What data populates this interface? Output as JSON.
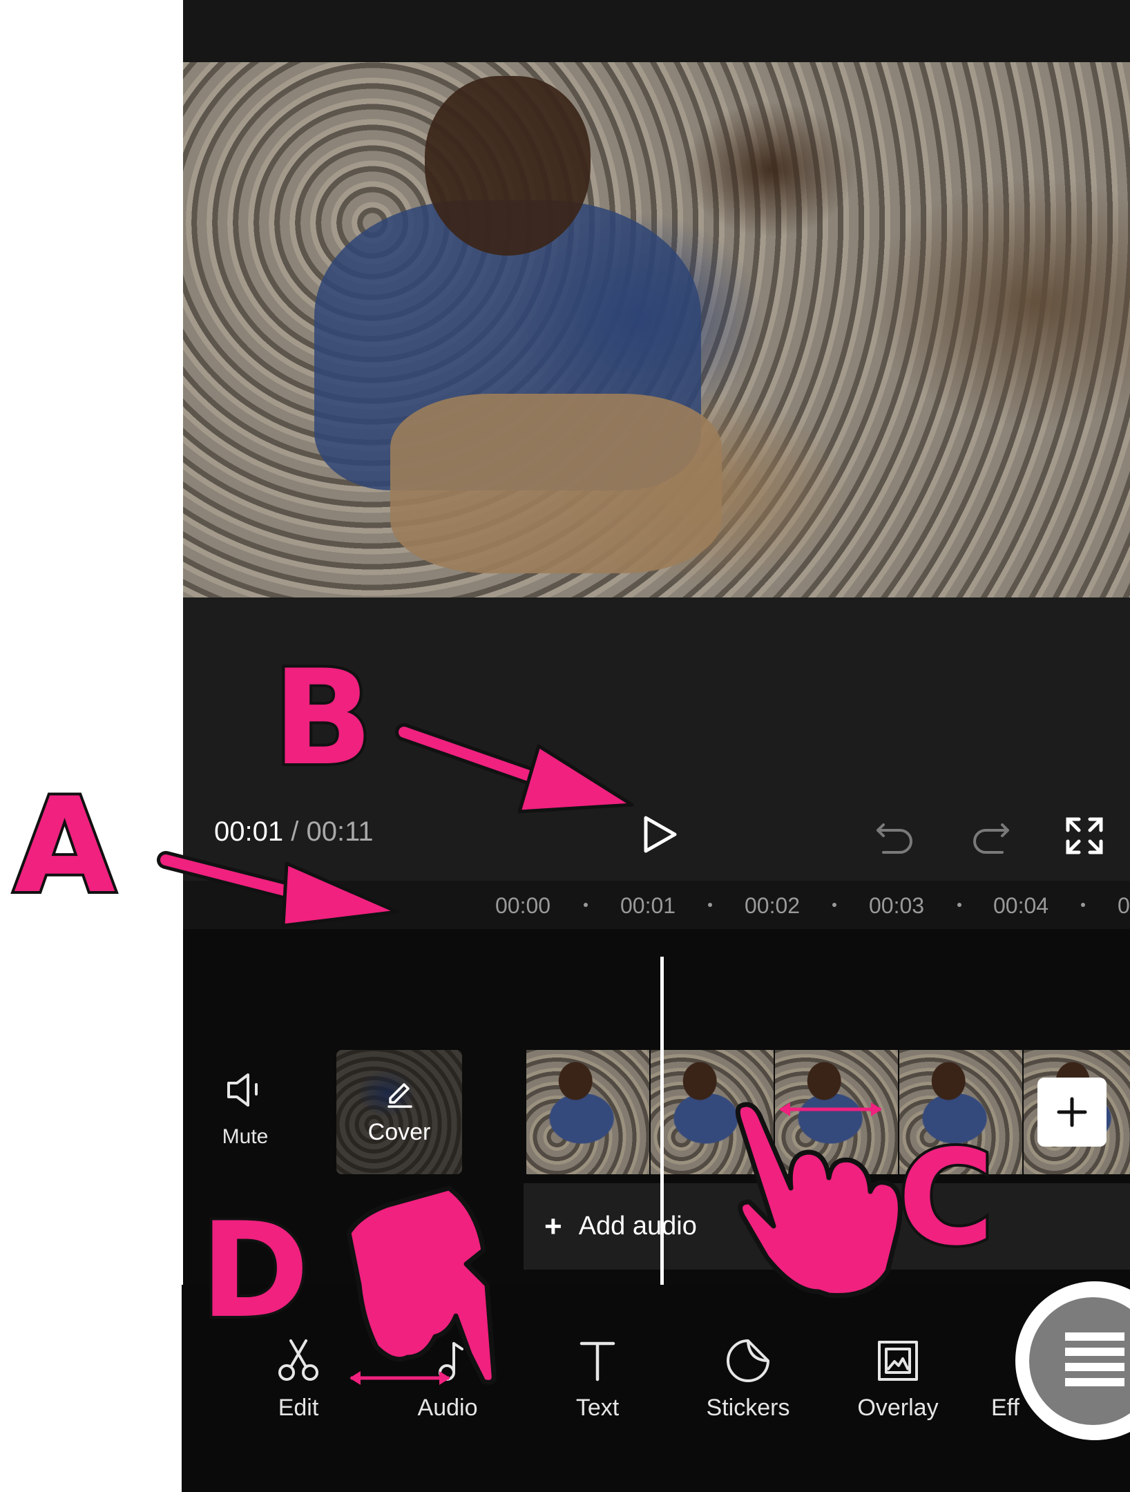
{
  "playback": {
    "current_time": "00:01",
    "separator": "/",
    "total_time": "00:11"
  },
  "ruler": {
    "ticks": [
      "00:00",
      "00:01",
      "00:02",
      "00:03",
      "00:04",
      "0"
    ]
  },
  "track": {
    "mute_label": "Mute",
    "cover_label": "Cover",
    "add_audio_label": "Add audio",
    "add_audio_plus": "+"
  },
  "toolbar": {
    "items": [
      {
        "label": "Edit",
        "icon": "scissors-icon"
      },
      {
        "label": "Audio",
        "icon": "music-note-icon"
      },
      {
        "label": "Text",
        "icon": "text-icon"
      },
      {
        "label": "Stickers",
        "icon": "sticker-icon"
      },
      {
        "label": "Overlay",
        "icon": "overlay-icon"
      },
      {
        "label": "Eff",
        "icon": "effects-icon"
      }
    ]
  },
  "annotations": {
    "letters": [
      "A",
      "B",
      "C",
      "D"
    ],
    "color": "#f0217f"
  },
  "colors": {
    "accent": "#f0217f",
    "panel": "#1c1c1c",
    "timeline_bg": "#0b0b0b"
  }
}
